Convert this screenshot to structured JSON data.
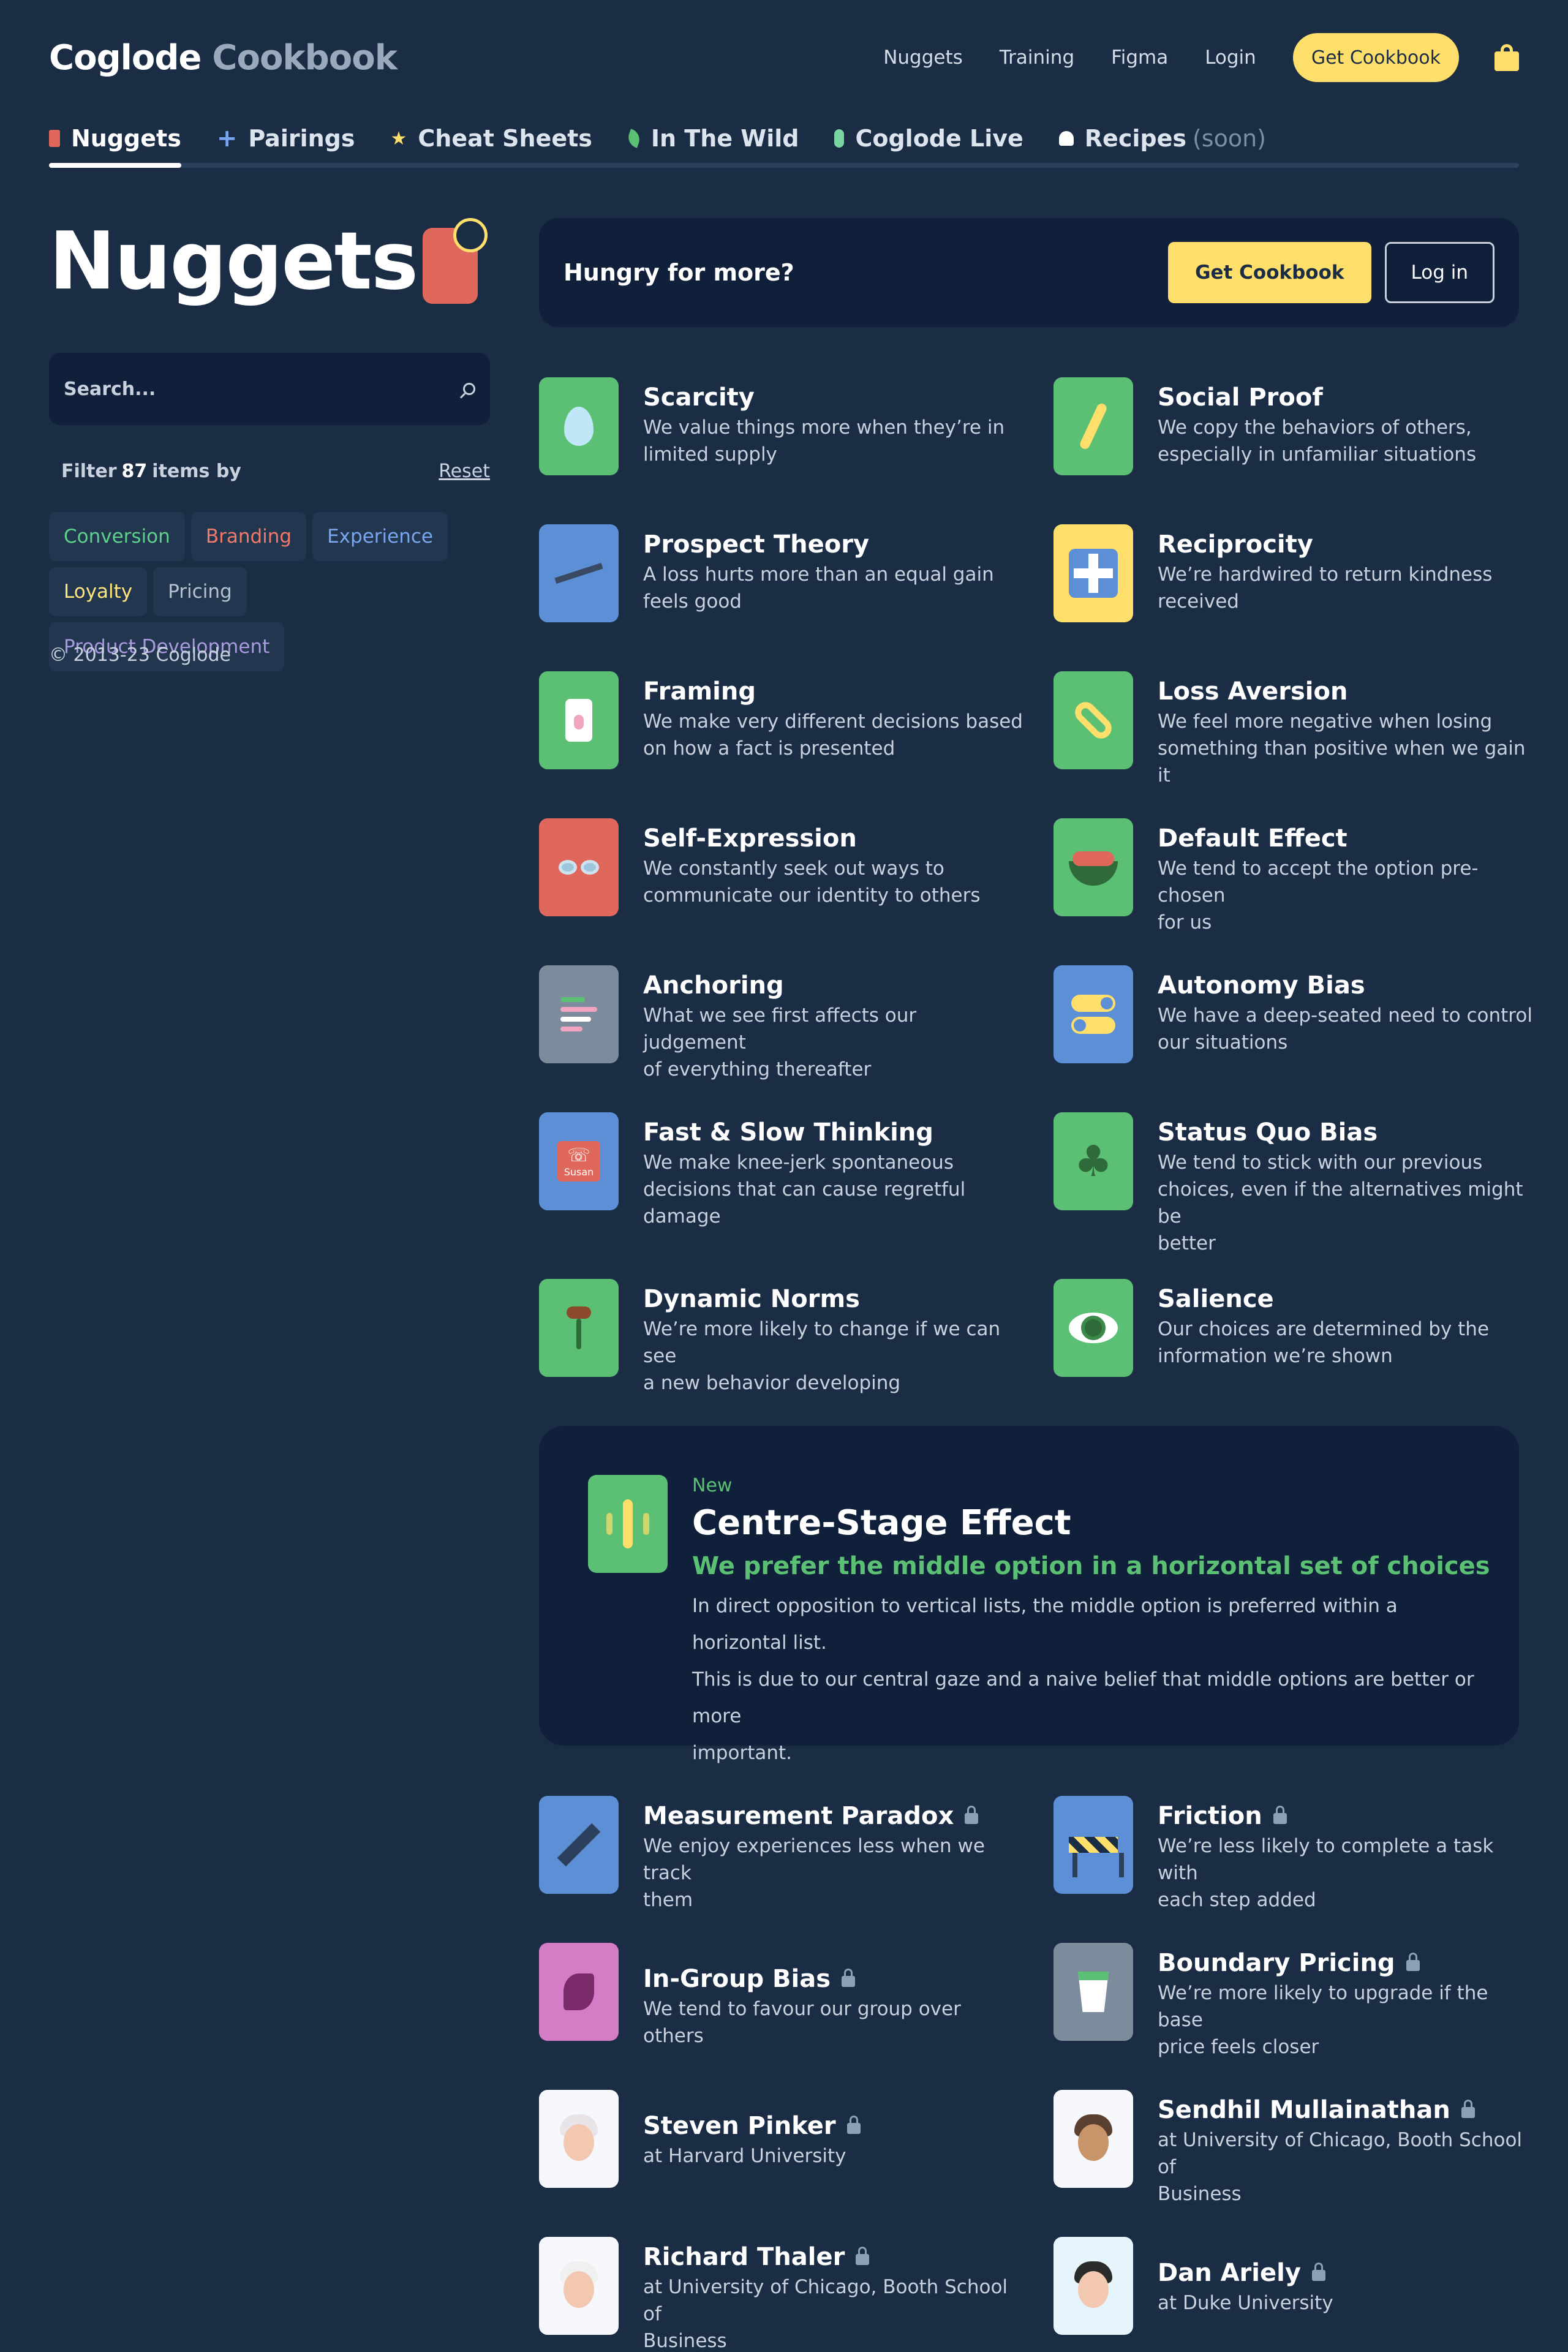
{
  "brand": {
    "name": "Coglode",
    "product": "Cookbook"
  },
  "topnav": {
    "links": [
      "Nuggets",
      "Training",
      "Figma",
      "Login"
    ],
    "cta": "Get Cookbook"
  },
  "tabs": [
    {
      "label": "Nuggets",
      "icon": "nugget-icon"
    },
    {
      "label": "Pairings",
      "icon": "plus-icon"
    },
    {
      "label": "Cheat Sheets",
      "icon": "star-icon"
    },
    {
      "label": "In The Wild",
      "icon": "leaf-icon"
    },
    {
      "label": "Coglode Live",
      "icon": "mic-icon"
    },
    {
      "label": "Recipes",
      "suffix": "(soon)",
      "icon": "chef-hat-icon"
    }
  ],
  "sidebar": {
    "title": "Nuggets",
    "search_placeholder": "Search...",
    "filter_prefix": "Filter",
    "filter_count": "87",
    "filter_suffix": "items by",
    "reset": "Reset",
    "chips": [
      {
        "label": "Conversion",
        "color": "#5cd18a"
      },
      {
        "label": "Branding",
        "color": "#f07a6a"
      },
      {
        "label": "Experience",
        "color": "#79a6f0"
      },
      {
        "label": "Loyalty",
        "color": "#ffe57a"
      },
      {
        "label": "Pricing",
        "color": "#b7c2cf"
      },
      {
        "label": "Product Development",
        "color": "#a99ae0"
      }
    ],
    "copyright": "© 2013-23 Coglode"
  },
  "promo": {
    "title": "Hungry for more?",
    "primary": "Get Cookbook",
    "secondary": "Log in"
  },
  "nuggets": [
    {
      "title": "Scarcity",
      "desc": [
        "We value things more when they’re in",
        "limited supply"
      ]
    },
    {
      "title": "Social Proof",
      "desc": [
        "We copy the behaviors of others,",
        "especially in unfamiliar situations"
      ]
    },
    {
      "title": "Prospect Theory",
      "desc": [
        "A loss hurts more than an equal gain",
        "feels good"
      ]
    },
    {
      "title": "Reciprocity",
      "desc": [
        "We’re hardwired to return kindness",
        "received"
      ]
    },
    {
      "title": "Framing",
      "desc": [
        "We make very different decisions based",
        "on how a fact is presented"
      ]
    },
    {
      "title": "Loss Aversion",
      "desc": [
        "We feel more negative when losing",
        "something than positive when we gain it"
      ]
    },
    {
      "title": "Self-Expression",
      "desc": [
        "We constantly seek out ways to",
        "communicate our identity to others"
      ]
    },
    {
      "title": "Default Effect",
      "desc": [
        "We tend to accept the option pre-chosen",
        "for us"
      ]
    },
    {
      "title": "Anchoring",
      "desc": [
        "What we see first affects our judgement",
        "of everything thereafter"
      ]
    },
    {
      "title": "Autonomy Bias",
      "desc": [
        "We have a deep-seated need to control",
        "our situations"
      ]
    },
    {
      "title": "Fast & Slow Thinking",
      "desc": [
        "We make knee-jerk spontaneous",
        "decisions that can cause regretful",
        "damage"
      ]
    },
    {
      "title": "Status Quo Bias",
      "desc": [
        "We tend to stick with our previous",
        "choices, even if the alternatives might be",
        "better"
      ]
    },
    {
      "title": "Dynamic Norms",
      "desc": [
        "We’re more likely to change if we can see",
        "a new behavior developing"
      ]
    },
    {
      "title": "Salience",
      "desc": [
        "Our choices are determined by the",
        "information we’re shown"
      ]
    }
  ],
  "feature": {
    "badge": "New",
    "title": "Centre-Stage Effect",
    "subtitle": "We prefer the middle option in a horizontal set of choices",
    "desc": [
      "In direct opposition to vertical lists, the middle option is preferred within a horizontal list.",
      "This is due to our central gaze and a naive belief that middle options are better or more",
      "important."
    ]
  },
  "locked": [
    {
      "title": "Measurement Paradox",
      "desc": [
        "We enjoy experiences less when we track",
        "them"
      ]
    },
    {
      "title": "Friction",
      "desc": [
        "We’re less likely to complete a task with",
        "each step added"
      ]
    },
    {
      "title": "In-Group Bias",
      "desc": [
        "We tend to favour our group over others"
      ]
    },
    {
      "title": "Boundary Pricing",
      "desc": [
        "We’re more likely to upgrade if the base",
        "price feels closer"
      ]
    },
    {
      "title": "Steven Pinker",
      "desc": [
        "at Harvard University"
      ]
    },
    {
      "title": "Sendhil Mullainathan",
      "desc": [
        "at University of Chicago, Booth School of",
        "Business"
      ]
    },
    {
      "title": "Richard Thaler",
      "desc": [
        "at University of Chicago, Booth School of",
        "Business"
      ]
    },
    {
      "title": "Dan Ariely",
      "desc": [
        "at Duke University"
      ]
    }
  ]
}
